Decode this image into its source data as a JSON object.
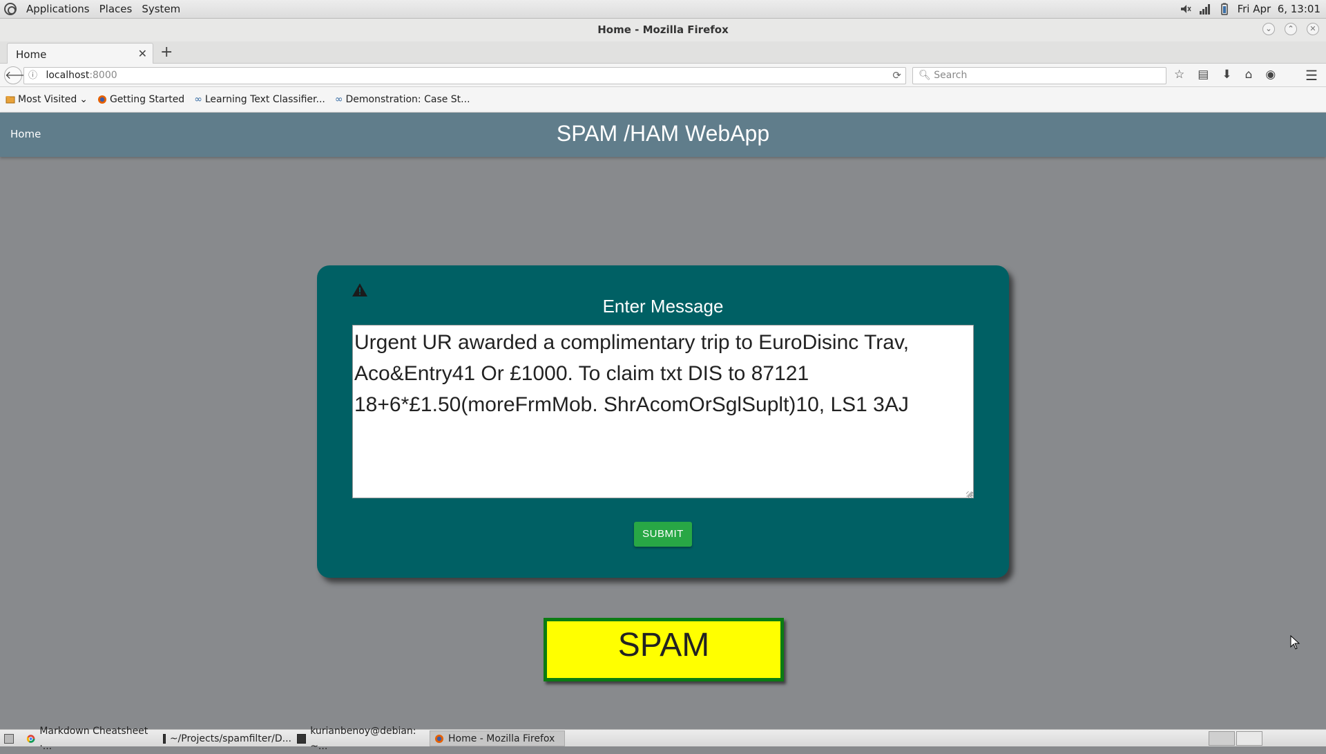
{
  "panel": {
    "menus": [
      "Applications",
      "Places",
      "System"
    ],
    "clock": "Fri Apr  6, 13:01"
  },
  "browser": {
    "window_title": "Home - Mozilla Firefox",
    "tab_label": "Home",
    "url_host": "localhost",
    "url_port": ":8000",
    "search_placeholder": "Search",
    "bookmarks": [
      "Most Visited",
      "Getting Started",
      "Learning Text Classifier...",
      "Demonstration: Case St..."
    ]
  },
  "app": {
    "nav_home": "Home",
    "title": "SPAM /HAM WebApp",
    "form_title": "Enter Message",
    "message": "Urgent UR awarded a complimentary trip to EuroDisinc Trav, Aco&Entry41 Or £1000. To claim txt DIS to 87121 18+6*£1.50(moreFrmMob. ShrAcomOrSglSuplt)10, LS1 3AJ",
    "submit_label": "SUBMIT",
    "result": "SPAM",
    "colors": {
      "header": "#607d8b",
      "card": "#006064",
      "submit": "#28a745",
      "result_bg": "#ffff00",
      "result_border": "#0b7c12"
    }
  },
  "taskbar": {
    "items": [
      "Markdown Cheatsheet ·...",
      "~/Projects/spamfilter/D...",
      "kurianbenoy@debian: ~...",
      "Home - Mozilla Firefox"
    ]
  }
}
